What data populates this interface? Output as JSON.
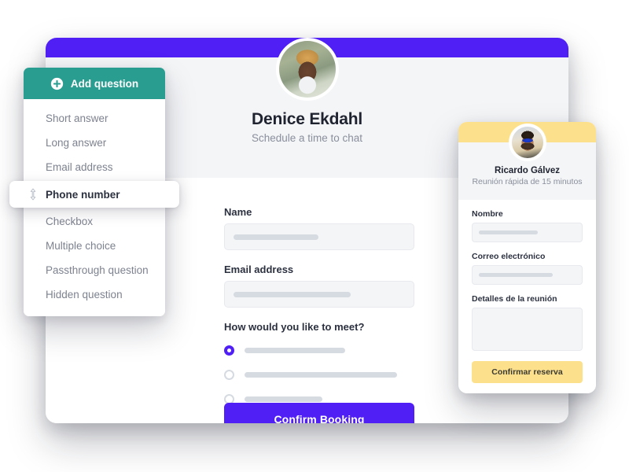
{
  "question_panel": {
    "header_label": "Add question",
    "header_icon": "plus-circle-icon",
    "items": [
      {
        "label": "Short answer",
        "active": false
      },
      {
        "label": "Long answer",
        "active": false
      },
      {
        "label": "Email address",
        "active": false
      },
      {
        "label": "Phone number",
        "active": true,
        "icon": "drag-vertical-icon"
      },
      {
        "label": "Checkbox",
        "active": false
      },
      {
        "label": "Multiple choice",
        "active": false
      },
      {
        "label": "Passthrough question",
        "active": false
      },
      {
        "label": "Hidden question",
        "active": false
      }
    ]
  },
  "main_card": {
    "accent_color": "#4f1ff5",
    "person_name": "Denice Ekdahl",
    "person_subtitle": "Schedule a time to chat",
    "avatar_name": "denice-avatar",
    "fields": [
      {
        "label": "Name",
        "value": "",
        "ghost_width": "47%"
      },
      {
        "label": "Email address",
        "value": "",
        "ghost_width": "65%"
      }
    ],
    "choice_question": {
      "label": "How would you like to meet?",
      "options": [
        {
          "selected": true,
          "ghost_width": "53%"
        },
        {
          "selected": false,
          "ghost_width": "80%"
        },
        {
          "selected": false,
          "ghost_width": "41%"
        }
      ]
    },
    "submit_label": "Confirm Booking"
  },
  "spanish_card": {
    "accent_color": "#fce08c",
    "person_name": "Ricardo Gálvez",
    "person_subtitle": "Reunión rápida de 15 minutos",
    "avatar_name": "ricardo-avatar",
    "fields": [
      {
        "label": "Nombre",
        "ghost_width": "57%"
      },
      {
        "label": "Correo electrónico",
        "ghost_width": "72%"
      },
      {
        "label": "Detalles de la reunión",
        "ghost_width": "0%"
      }
    ],
    "submit_label": "Confirmar reserva"
  }
}
